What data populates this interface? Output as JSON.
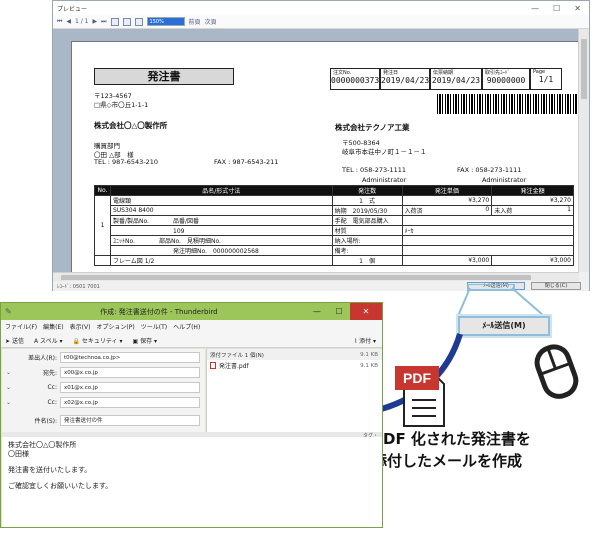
{
  "preview": {
    "title": "プレビュー",
    "toolbar": {
      "page": "1 / 1",
      "zoom": "150%",
      "prev": "前頁",
      "next": "次頁"
    },
    "document": {
      "title": "発注書",
      "info_labels": [
        "注文No.",
        "発注日",
        "伝票納期",
        "取引先ｺｰﾄﾞ",
        "Page"
      ],
      "info_values": [
        "0000000373",
        "2019/04/23",
        "2019/04/23",
        "90000000",
        "1/1"
      ],
      "left_postal": "〒123-4567",
      "left_address": "□県◇市〇丘1-1-1",
      "left_company": "株式会社〇△〇製作所",
      "left_dept": "購買部門",
      "left_person": "〇田 △部　様",
      "left_tel": "TEL : 987-6543-210",
      "left_fax": "FAX : 987-6543-211",
      "right_company": "株式会社テクノア工業",
      "right_postal": "〒500-8364",
      "right_address": "岐阜市本荘中ノ町１－１－１",
      "right_tel": "TEL : 058-273-1111",
      "right_fax": "FAX : 058-273-1111",
      "right_staff1": "Administrator",
      "right_staff2": "Administrator",
      "table_headers": [
        "No.",
        "品名/形式寸法",
        "発注数",
        "発注単価",
        "発注金額"
      ],
      "row1": {
        "no": "1",
        "name": "電線類",
        "spec": "SUS304 8400",
        "maker_label": "製番/製品No.",
        "part_label": "品番/図番",
        "part_value": "109",
        "unit_label": "ﾕﾆｯﾄNo.",
        "parts_label": "部品No.",
        "quote_label": "見積明細No.",
        "order_label": "発注明細No.",
        "order_value": "000000002568",
        "qty": "1",
        "qty_unit": "式",
        "price": "¥3,270",
        "amount": "¥3,270",
        "delivery": "納期　2019/05/30",
        "stock": "入荷済",
        "zero": "0",
        "unarrived": "未入荷",
        "unarrived_qty": "1",
        "procure_label": "手配",
        "procure_value": "電気部品購入",
        "material_label": "材質",
        "memo": "ﾒｰｶ",
        "dest_label": "納入場所:",
        "remarks_label": "備考:"
      },
      "row2": {
        "name": "フレーム図 1/2",
        "qty": "1",
        "qty_unit": "個",
        "price": "¥3,000",
        "amount": "¥3,000"
      }
    },
    "status": "ﾚｺｰﾄﾞ: 0501 7001",
    "mail_button": "ﾒｰﾙ送信(M)",
    "close_button": "閉じる(C)"
  },
  "thunderbird": {
    "title": "作成: 発注書送付の件 - Thunderbird",
    "menu": [
      "ファイル(F)",
      "編集(E)",
      "表示(V)",
      "オプション(P)",
      "ツール(T)",
      "ヘルプ(H)"
    ],
    "toolbar": [
      "送信",
      "スペル",
      "セキュリティ",
      "保存"
    ],
    "attach_button": "添付",
    "from_label": "差出人(R):",
    "from_value": "t00@technoa.co.jp>",
    "to_label": "宛先:",
    "to_value": "x00@x.co.jp",
    "cc_label": "Cc:",
    "cc1": "x01@x.co.jp",
    "cc2": "x02@x.co.jp",
    "subject_label": "件名(S):",
    "subject_value": "発注書送付の件",
    "attach_header": "添付ファイル 1 個(N)",
    "attach_header_size": "9.1 KB",
    "attach_file": "発注書.pdf",
    "attach_size": "9.1 KB",
    "tag_label": "タグ・",
    "body": [
      "株式会社〇△〇製作所",
      "〇田様",
      "",
      "発注書を送付いたします。",
      "",
      "ご確認宜しくお願いいたします。"
    ]
  },
  "callout": {
    "button": "ﾒｰﾙ送信(M)",
    "pdf": "PDF",
    "caption_line1": "PDF 化された発注書を",
    "caption_line2": "添付したメールを作成"
  }
}
